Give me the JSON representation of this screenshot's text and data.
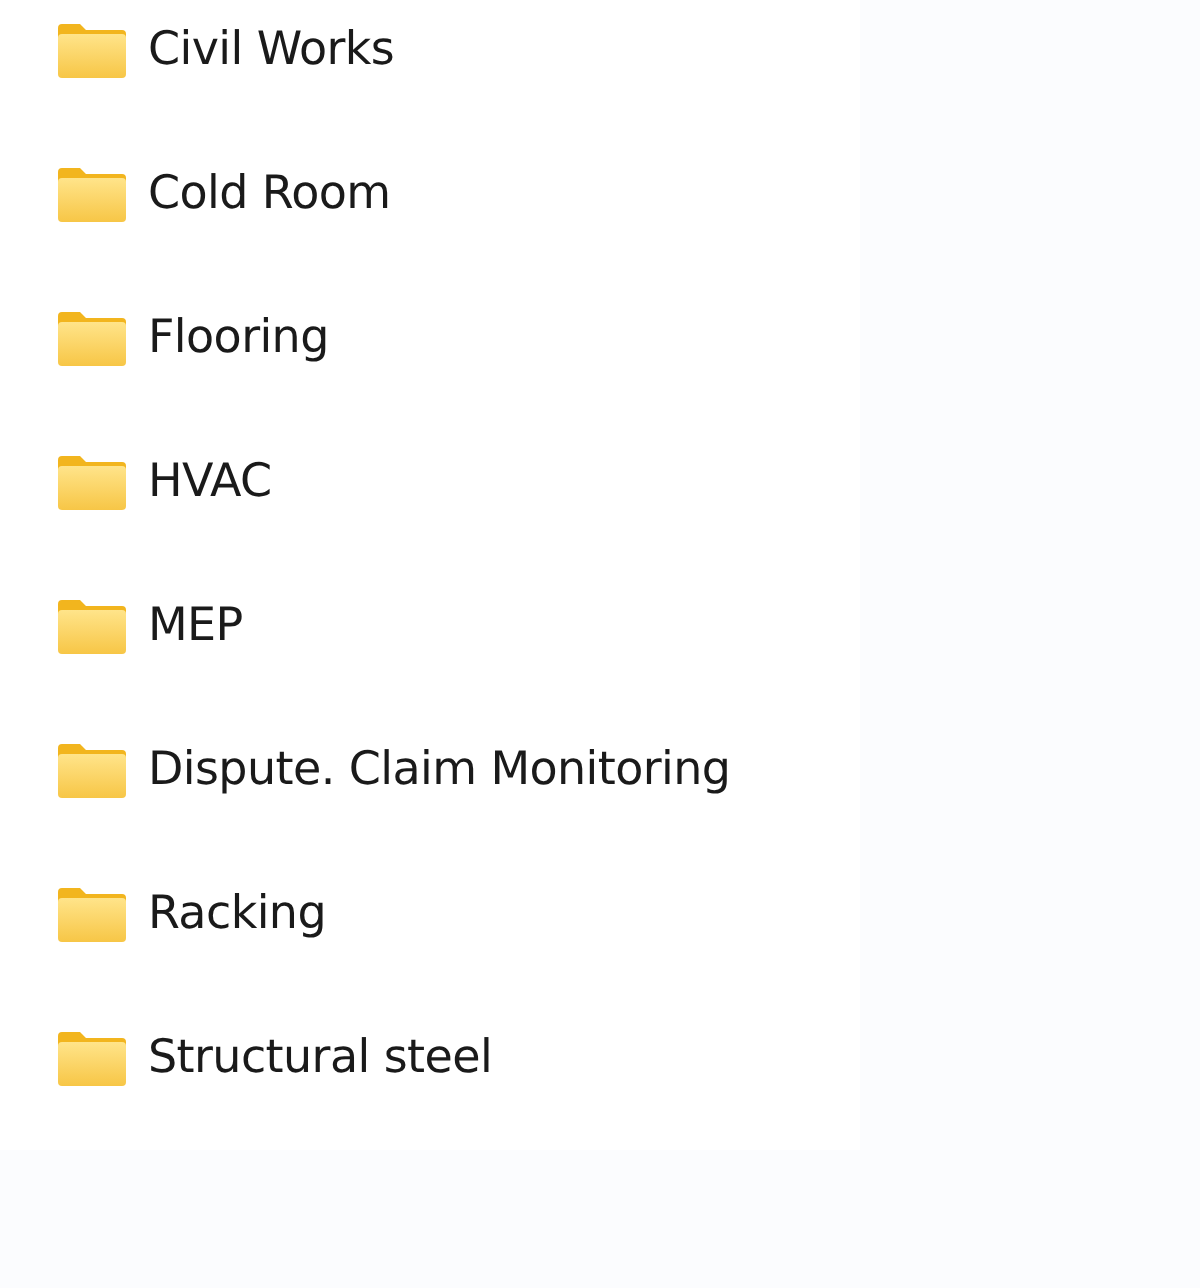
{
  "folders": [
    {
      "name": "Civil Works"
    },
    {
      "name": "Cold Room"
    },
    {
      "name": "Flooring"
    },
    {
      "name": "HVAC"
    },
    {
      "name": "MEP"
    },
    {
      "name": "Dispute. Claim Monitoring"
    },
    {
      "name": "Racking"
    },
    {
      "name": "Structural steel"
    }
  ]
}
